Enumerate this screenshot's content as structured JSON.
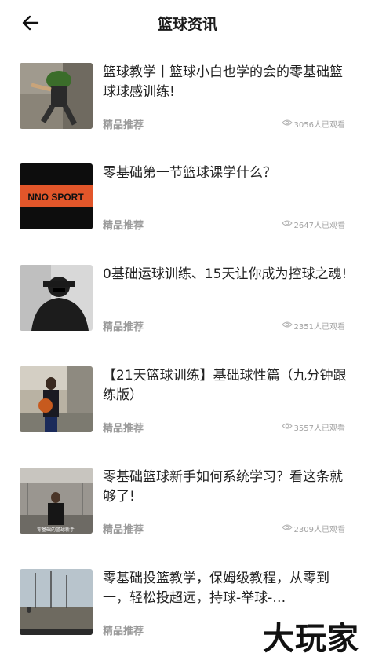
{
  "header": {
    "title": "篮球资讯"
  },
  "articles": [
    {
      "title": "篮球教学丨篮球小白也学的会的零基础篮球球感训练!",
      "tag": "精品推荐",
      "views": "3056人已观看",
      "thumb_desc": "player-jumping"
    },
    {
      "title": "零基础第一节篮球课学什么？",
      "tag": "精品推荐",
      "views": "2647人已观看",
      "thumb_text": "NNO SPORT"
    },
    {
      "title": "0基础运球训练、15天让你成为控球之魂!",
      "tag": "精品推荐",
      "views": "2351人已观看"
    },
    {
      "title": "【21天篮球训练】基础球性篇（九分钟跟练版）",
      "tag": "精品推荐",
      "views": "3557人已观看"
    },
    {
      "title": "零基础篮球新手如何系统学习？看这条就够了!",
      "tag": "精品推荐",
      "views": "2309人已观看",
      "thumb_caption": "零基础的篮球新手"
    },
    {
      "title": "零基础投篮教学，保姆级教程，从零到一，轻松投超远，持球-举球-…",
      "tag": "精品推荐",
      "views": ""
    }
  ],
  "watermark": "大玩家",
  "colors": {
    "accent_orange": "#e2562a",
    "tag_gray": "#9a9a9a"
  }
}
